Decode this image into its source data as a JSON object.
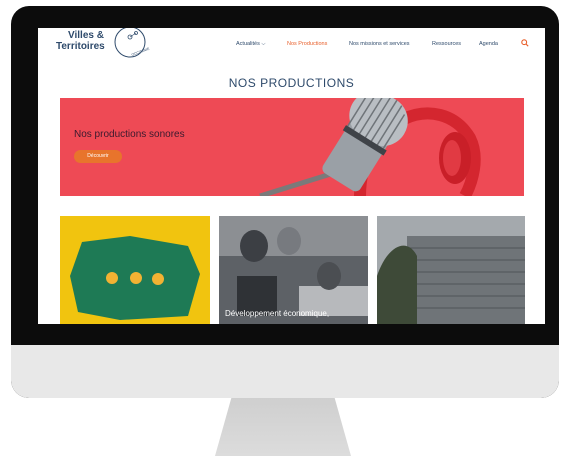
{
  "logo": {
    "line1": "Villes &",
    "line2": "Territoires",
    "tag": "OCCITANIE"
  },
  "nav": [
    {
      "label": "Actualités ⌵",
      "active": false
    },
    {
      "label": "Nos Productions",
      "active": true
    },
    {
      "label": "Nos missions et services",
      "active": false
    },
    {
      "label": "Ressources",
      "active": false
    },
    {
      "label": "Agenda",
      "active": false
    }
  ],
  "page_title": "NOS PRODUCTIONS",
  "banner": {
    "title": "Nos productions sonores",
    "button": "Découvrir"
  },
  "cards": [
    {
      "caption": ""
    },
    {
      "caption": "Développement économique,"
    },
    {
      "caption": ""
    }
  ],
  "colors": {
    "accent": "#e8602c",
    "banner": "#ee4a55",
    "navy": "#2e4a6b"
  }
}
